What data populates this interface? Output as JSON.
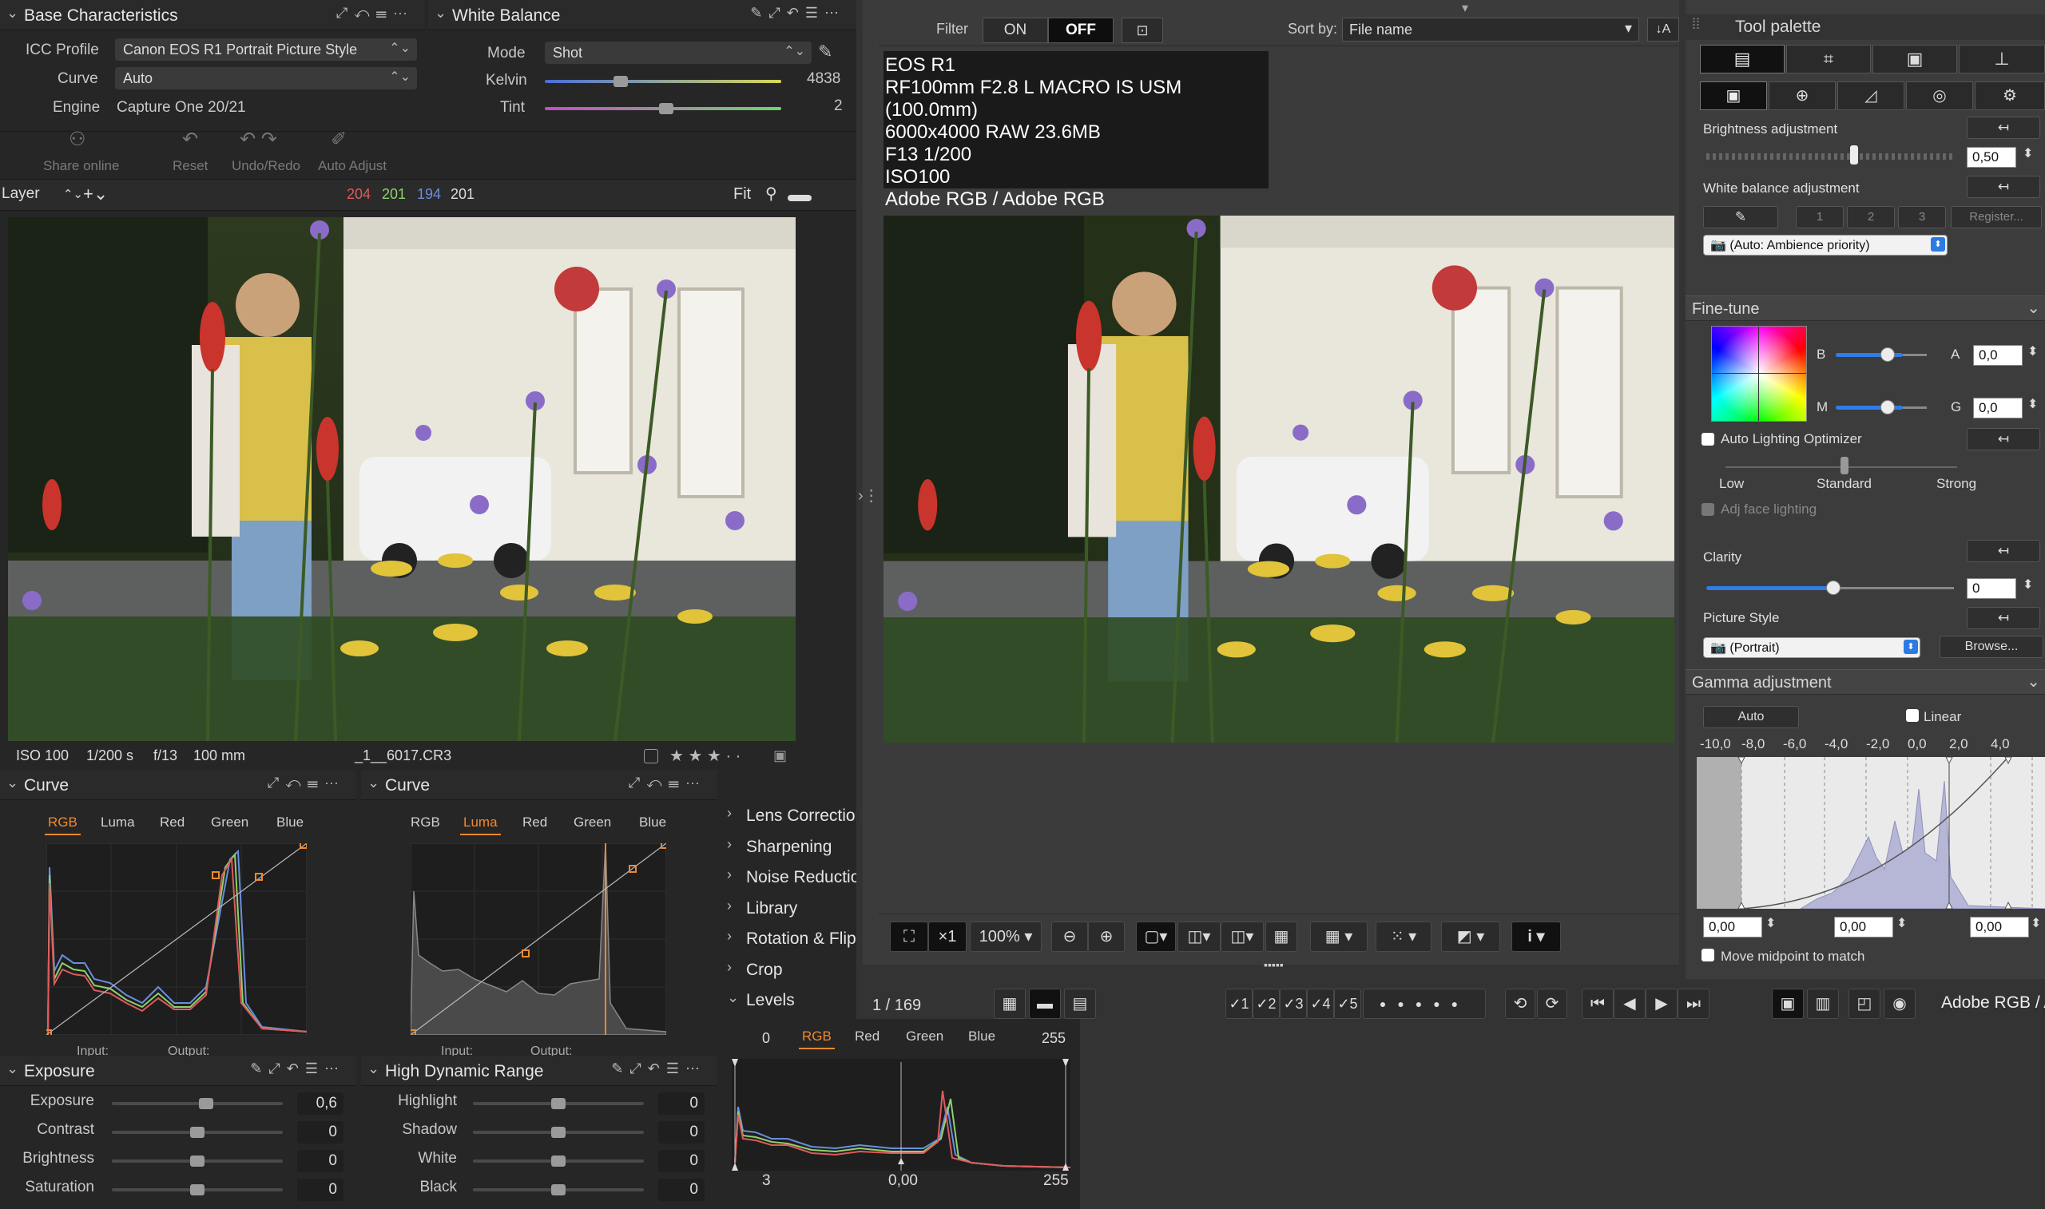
{
  "left": {
    "base": {
      "title": "Base Characteristics",
      "icc_label": "ICC Profile",
      "icc_value": "Canon EOS R1 Portrait Picture Style",
      "curve_label": "Curve",
      "curve_value": "Auto",
      "engine_label": "Engine",
      "engine_value": "Capture One 20/21"
    },
    "wb": {
      "title": "White Balance",
      "mode_label": "Mode",
      "mode_value": "Shot",
      "kelvin_label": "Kelvin",
      "kelvin_value": "4838",
      "tint_label": "Tint",
      "tint_value": "2"
    },
    "toolbar": {
      "share": "Share online",
      "reset": "Reset",
      "undo": "Undo/Redo",
      "auto": "Auto Adjust"
    },
    "layer": {
      "label": "Layer",
      "r": "204",
      "g": "201",
      "b": "194",
      "l": "201",
      "fit": "Fit"
    },
    "meta": {
      "iso": "ISO 100",
      "shutter": "1/200 s",
      "aperture": "f/13",
      "focal": "100 mm",
      "file": "_1__6017.CR3",
      "stars": "★ ★ ★ · ·"
    },
    "curve1": {
      "title": "Curve",
      "tabs": [
        "RGB",
        "Luma",
        "Red",
        "Green",
        "Blue"
      ],
      "active": 0,
      "input": "Input:",
      "output": "Output:"
    },
    "curve2": {
      "title": "Curve",
      "tabs": [
        "RGB",
        "Luma",
        "Red",
        "Green",
        "Blue"
      ],
      "active": 1,
      "input": "Input:",
      "output": "Output:"
    },
    "exposure": {
      "title": "Exposure",
      "rows": [
        {
          "label": "Exposure",
          "value": "0,6",
          "pos": 0.55
        },
        {
          "label": "Contrast",
          "value": "0",
          "pos": 0.5
        },
        {
          "label": "Brightness",
          "value": "0",
          "pos": 0.5
        },
        {
          "label": "Saturation",
          "value": "0",
          "pos": 0.5
        }
      ]
    },
    "hdr": {
      "title": "High Dynamic Range",
      "rows": [
        {
          "label": "Highlight",
          "value": "0",
          "pos": 0.5
        },
        {
          "label": "Shadow",
          "value": "0",
          "pos": 0.5
        },
        {
          "label": "White",
          "value": "0",
          "pos": 0.5
        },
        {
          "label": "Black",
          "value": "0",
          "pos": 0.5
        }
      ]
    },
    "tools_list": [
      "Lens Correction",
      "Sharpening",
      "Noise Reduction",
      "Library",
      "Rotation & Flip",
      "Crop",
      "Levels"
    ],
    "levels": {
      "left_val": "0",
      "right_val": "255",
      "tabs": [
        "RGB",
        "Red",
        "Green",
        "Blue"
      ],
      "bottom_left": "3",
      "bottom_mid": "0,00",
      "bottom_right": "255"
    }
  },
  "center": {
    "filter_label": "Filter",
    "on": "ON",
    "off": "OFF",
    "sort_label": "Sort by:",
    "sort_value": "File name",
    "sort_dir": "↓A",
    "info": [
      "EOS R1",
      "RF100mm F2.8 L MACRO IS USM (100.0mm)",
      "6000x4000 RAW 23.6MB",
      "F13 1/200",
      "ISO100",
      "Adobe RGB / Adobe RGB"
    ],
    "zoom_x": "×1",
    "zoom_pct": "100%",
    "counter": "1 / 169",
    "ratings": [
      "✓1",
      "✓2",
      "✓3",
      "✓4",
      "✓5"
    ],
    "color_space": "Adobe RGB / A"
  },
  "right": {
    "title": "Tool palette",
    "brightness": {
      "label": "Brightness adjustment",
      "value": "0,50"
    },
    "wb": {
      "label": "White balance adjustment",
      "slots": [
        "1",
        "2",
        "3"
      ],
      "register": "Register...",
      "value": "(Auto: Ambience priority)"
    },
    "finetune": {
      "title": "Fine-tune",
      "b": "B",
      "a": "A",
      "m": "M",
      "g": "G",
      "a_val": "0,0",
      "g_val": "0,0",
      "alo": "Auto Lighting Optimizer",
      "low": "Low",
      "standard": "Standard",
      "strong": "Strong",
      "face": "Adj face lighting"
    },
    "clarity": {
      "label": "Clarity",
      "value": "0"
    },
    "picture_style": {
      "label": "Picture Style",
      "value": "(Portrait)",
      "browse": "Browse..."
    },
    "gamma": {
      "title": "Gamma adjustment",
      "auto": "Auto",
      "linear": "Linear",
      "ticks": [
        "-10,0",
        "-8,0",
        "-6,0",
        "-4,0",
        "-2,0",
        "0,0",
        "2,0",
        "4,0"
      ],
      "v1": "0,00",
      "v2": "0,00",
      "v3": "0,00",
      "midpoint": "Move midpoint to match"
    }
  },
  "colors": {
    "accent": "#f08a2c",
    "red": "#e05a5a",
    "green": "#8fd16a",
    "blue": "#6a8ee0",
    "blue_ui": "#2e7de8"
  }
}
